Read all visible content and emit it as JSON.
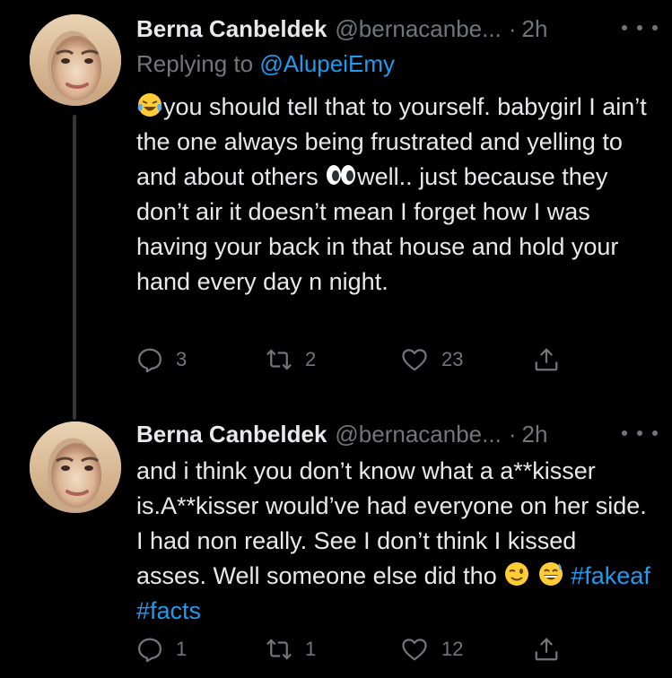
{
  "colors": {
    "background": "#000000",
    "text_primary": "#e7e9ea",
    "text_secondary": "#71767b",
    "accent": "#1d9bf0",
    "thread_line": "#333639"
  },
  "tweets": [
    {
      "display_name": "Berna Canbeldek",
      "handle": "@bernacanbe...",
      "separator": "·",
      "time": "2h",
      "replying_prefix": "Replying to",
      "replying_to": "@AlupeiEmy",
      "text_lead_emoji": "face-with-tears-of-joy",
      "text_part1": "you should tell that to yourself. babygirl I ain’t the one always being frustrated and yelling to and about others ",
      "text_mid_emoji": "eyes",
      "text_part2": "well.. just because they don’t air it doesn’t mean I forget how I was having your back in that house and hold your hand every day n night.",
      "replies": "3",
      "retweets": "2",
      "likes": "23"
    },
    {
      "display_name": "Berna Canbeldek",
      "handle": "@bernacanbe...",
      "separator": "·",
      "time": "2h",
      "text_part1": "and i think you don’t know what a a**kisser is.A**kisser would’ve had everyone on her side. I had non really. See I don’t think I kissed asses. Well someone else did tho ",
      "text_emojis": [
        "winking-face",
        "grinning-face-with-sweat"
      ],
      "hashtags": [
        "#fakeaf",
        "#facts"
      ],
      "replies": "1",
      "retweets": "1",
      "likes": "12"
    }
  ],
  "icons": {
    "reply": "reply-icon",
    "retweet": "retweet-icon",
    "like": "heart-icon",
    "share": "share-icon",
    "more": "more-icon"
  }
}
